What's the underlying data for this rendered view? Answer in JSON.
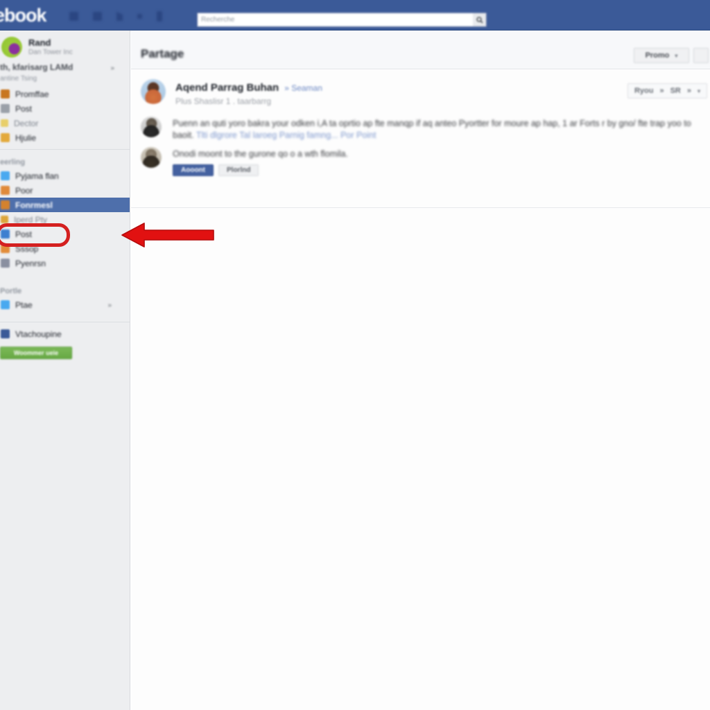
{
  "topbar": {
    "brand": "ebook",
    "background": "#3b5a98",
    "icons": [
      "grid-icon",
      "friends-icon",
      "messenger-icon",
      "notification-dot-icon",
      "bell-icon"
    ],
    "search": {
      "placeholder": "Recherche",
      "value": "",
      "icon": "search-icon"
    }
  },
  "sidebar": {
    "profile": {
      "avatar": "user-avatar",
      "name": "Rand",
      "subtitle": "Dan Tower Inc"
    },
    "group": {
      "title": "th, kfarisarg  LAMd",
      "more": "»",
      "subtitle": "antine  Tsing"
    },
    "top_items": [
      {
        "label": "Promffae",
        "icon": "pages-icon",
        "color": "#c8761f"
      },
      {
        "label": "Post",
        "icon": "post-icon",
        "color": "#9aa0a8"
      },
      {
        "label": "Dector",
        "icon": "folder-icon",
        "color": "#e8cf6a",
        "sub": true
      },
      {
        "label": "Hjulie",
        "icon": "tasks-icon",
        "color": "#e3a93c"
      }
    ],
    "section_label": "eerling",
    "items": [
      {
        "label": "Pyjama flan",
        "icon": "insights-icon",
        "color": "#49a9f0"
      },
      {
        "label": "Poor",
        "icon": "inbox-icon",
        "color": "#e08a3a"
      },
      {
        "label": "Fonrmesl",
        "icon": "feed-icon",
        "color": "#d4822e",
        "selected": true
      },
      {
        "label": "Iperd Pty",
        "icon": "settings-icon",
        "color": "#dca63c",
        "sub": true
      },
      {
        "label": "Post",
        "icon": "people-icon",
        "color": "#3e7fd0"
      },
      {
        "label": "Sssop",
        "icon": "store-icon",
        "color": "#e28c3a"
      },
      {
        "label": "Pyenrsn",
        "icon": "app-icon",
        "color": "#8a8fa0"
      }
    ],
    "section_label2": "Portle",
    "bottom_items": [
      {
        "label": "Ptae",
        "icon": "messenger-icon",
        "color": "#49a9f0",
        "badge": "»"
      }
    ],
    "footer_item": {
      "label": "Vtachoupine",
      "icon": "facebook-icon",
      "color": "#3b5a98"
    },
    "cta_button": {
      "label": "Woommer ueie",
      "color": "#6fae4d"
    }
  },
  "main": {
    "page_title": "Partage",
    "header_buttons": [
      {
        "label": "Promo",
        "caret": "▾"
      },
      {
        "label": "",
        "caret": ""
      }
    ],
    "post": {
      "author": "Aqend Parrag Buhan",
      "author_link": "» Seaman",
      "meta": "Plus Shaslisr 1 . taarbarrg",
      "avatar": "author-avatar",
      "action_button": {
        "segments": [
          "Ryou",
          "»",
          "SR",
          "»"
        ],
        "caret": "▾"
      }
    },
    "comments": [
      {
        "avatar": "commenter-avatar-1",
        "text": "Puenn an quti yoro bakra your odken i,A ta oprtio ap fte manqp if aq anteo Pyortter for moure ap hap, 1 ar Forts r by gno/ fte trap yoo to baoit.",
        "link": "Tlti dlgrore Tal laroeg Parnig famng...",
        "link2": "Por Point"
      },
      {
        "avatar": "commenter-avatar-2",
        "text": "Onodi moont to the gurone qo o a wth flomila.",
        "buttons": [
          {
            "label": "Aooont",
            "style": "primary"
          },
          {
            "label": "Plorlnd",
            "style": "secondary"
          }
        ]
      }
    ]
  },
  "annotations": {
    "highlight_box_color": "#d42020",
    "arrow_color": "#e11111",
    "arrow_direction": "left",
    "target": "sidebar-item-fonrmesl"
  }
}
